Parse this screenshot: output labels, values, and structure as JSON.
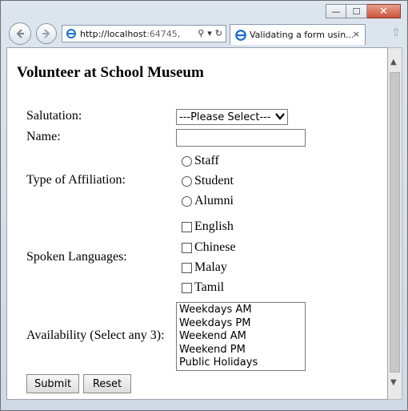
{
  "browser": {
    "url_host": "http://localhost",
    "url_rest": ":64745,",
    "tab_title": "Validating a form usin...",
    "tab_close": "×",
    "new_tab": "⇧"
  },
  "window_controls": {
    "minimize": "—",
    "maximize": "☐",
    "close": "✕"
  },
  "page": {
    "title": "Volunteer at School Museum",
    "salutation_label": "Salutation:",
    "salutation_value": "---Please Select---",
    "name_label": "Name:",
    "name_value": "",
    "affiliation_label": "Type of Affiliation:",
    "affiliation_options": [
      "Staff",
      "Student",
      "Alumni"
    ],
    "languages_label": "Spoken Languages:",
    "language_options": [
      "English",
      "Chinese",
      "Malay",
      "Tamil"
    ],
    "availability_label": "Availability (Select any 3):",
    "availability_options": [
      "Weekdays AM",
      "Weekdays PM",
      "Weekend AM",
      "Weekend PM",
      "Public Holidays"
    ],
    "submit_label": "Submit",
    "reset_label": "Reset"
  },
  "colors": {
    "ie_blue": "#1e6fc9",
    "close_red": "#c9543b"
  }
}
